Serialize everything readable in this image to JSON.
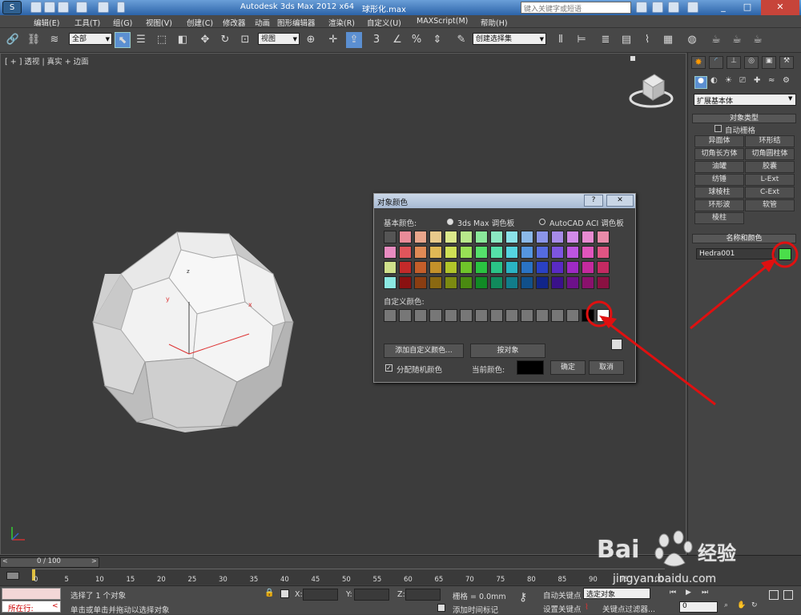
{
  "title": {
    "app": "Autodesk 3ds Max  2012 x64",
    "file": "球形化.max",
    "search_placeholder": "键入关键字或短语"
  },
  "menu": [
    "编辑(E)",
    "工具(T)",
    "组(G)",
    "视图(V)",
    "创建(C)",
    "修改器",
    "动画",
    "图形编辑器",
    "渲染(R)",
    "自定义(U)",
    "MAXScript(M)",
    "帮助(H)"
  ],
  "toolbar": {
    "filter": "全部",
    "ref_coord": "视图",
    "selection_set": "创建选择集",
    "snap_number": "3",
    "percent": "%"
  },
  "viewport": {
    "label": "[ + ] 透视 | 真实 + 边面",
    "gizmo_x": "x",
    "gizmo_y": "y",
    "gizmo_z": "z"
  },
  "command_panel": {
    "category": "扩展基本体",
    "rollout_object_type": "对象类型",
    "autogrid": "自动栅格",
    "object_buttons": [
      "异面体",
      "环形结",
      "切角长方体",
      "切角圆柱体",
      "油罐",
      "胶囊",
      "纺锤",
      "L-Ext",
      "球棱柱",
      "C-Ext",
      "环形波",
      "软管",
      "棱柱"
    ],
    "rollout_name_color": "名称和颜色",
    "object_name": "Hedra001",
    "object_color": "#4ade4a"
  },
  "dialog": {
    "title": "对象颜色",
    "help": "?",
    "close": "✕",
    "basic_colors_label": "基本颜色:",
    "radio_max": "3ds Max 调色板",
    "radio_acad": "AutoCAD ACI 调色板",
    "custom_colors_label": "自定义颜色:",
    "add_custom_button": "添加自定义颜色...",
    "by_object_button": "按对象",
    "assign_random_label": "分配随机颜色",
    "current_color_label": "当前颜色:",
    "current_color": "#000000",
    "ok_button": "确定",
    "cancel_button": "取消",
    "palette": [
      [
        "#555555",
        "#e88b98",
        "#e8a58b",
        "#e8c98b",
        "#dbe88b",
        "#b8e88b",
        "#8be89a",
        "#8be8c2",
        "#8be2e8",
        "#8bb8e8",
        "#8b95e8",
        "#a78be8",
        "#d18be8",
        "#e88bd1",
        "#e88ba9"
      ],
      [
        "#e88bc0",
        "#e0555b",
        "#e08a55",
        "#e0b855",
        "#cfe055",
        "#98e055",
        "#55e06b",
        "#55e0a9",
        "#55d4e0",
        "#5596e0",
        "#556be0",
        "#7e55e0",
        "#bc55e0",
        "#e055bc",
        "#e05583"
      ],
      [
        "#cfe08b",
        "#c42a2a",
        "#c45e2a",
        "#c4912a",
        "#b1c42a",
        "#6fc42a",
        "#2ac441",
        "#2ac487",
        "#2ab4c4",
        "#2a73c4",
        "#2a41c4",
        "#592ac4",
        "#9e2ac4",
        "#c42a9e",
        "#c42a62"
      ],
      [
        "#8be8e2",
        "#8a1111",
        "#8a3d11",
        "#8a6811",
        "#7c8a11",
        "#4a8a11",
        "#118a25",
        "#118a5c",
        "#117d8a",
        "#11508a",
        "#11258a",
        "#3a118a",
        "#6d118a",
        "#8a116d",
        "#8a1142"
      ]
    ],
    "custom_colors": [
      "#777777",
      "#777777",
      "#777777",
      "#777777",
      "#777777",
      "#777777",
      "#777777",
      "#777777",
      "#777777",
      "#777777",
      "#777777",
      "#777777",
      "#777777",
      "#000000",
      "#ffffff"
    ]
  },
  "timeline": {
    "frame_display": "0 / 100",
    "ticks": [
      "0",
      "5",
      "10",
      "15",
      "20",
      "25",
      "30",
      "35",
      "40",
      "45",
      "50",
      "55",
      "60",
      "65",
      "70",
      "75",
      "80",
      "85",
      "90",
      "95",
      "100"
    ]
  },
  "status": {
    "mini_listener": "所在行:",
    "selection_status": "选择了 1 个对象",
    "prompt": "单击或单击并拖动以选择对象",
    "x_label": "X:",
    "y_label": "Y:",
    "z_label": "Z:",
    "grid": "栅格 = 0.0mm",
    "add_time_tag": "添加时间标记",
    "auto_key": "自动关键点",
    "set_key": "设置关键点",
    "selected_object": "选定对象",
    "key_filters": "关键点过滤器...",
    "frame": "0"
  },
  "watermark": {
    "brand": "Bai",
    "brand2": "经验",
    "url": "jingyan.baidu.com"
  }
}
